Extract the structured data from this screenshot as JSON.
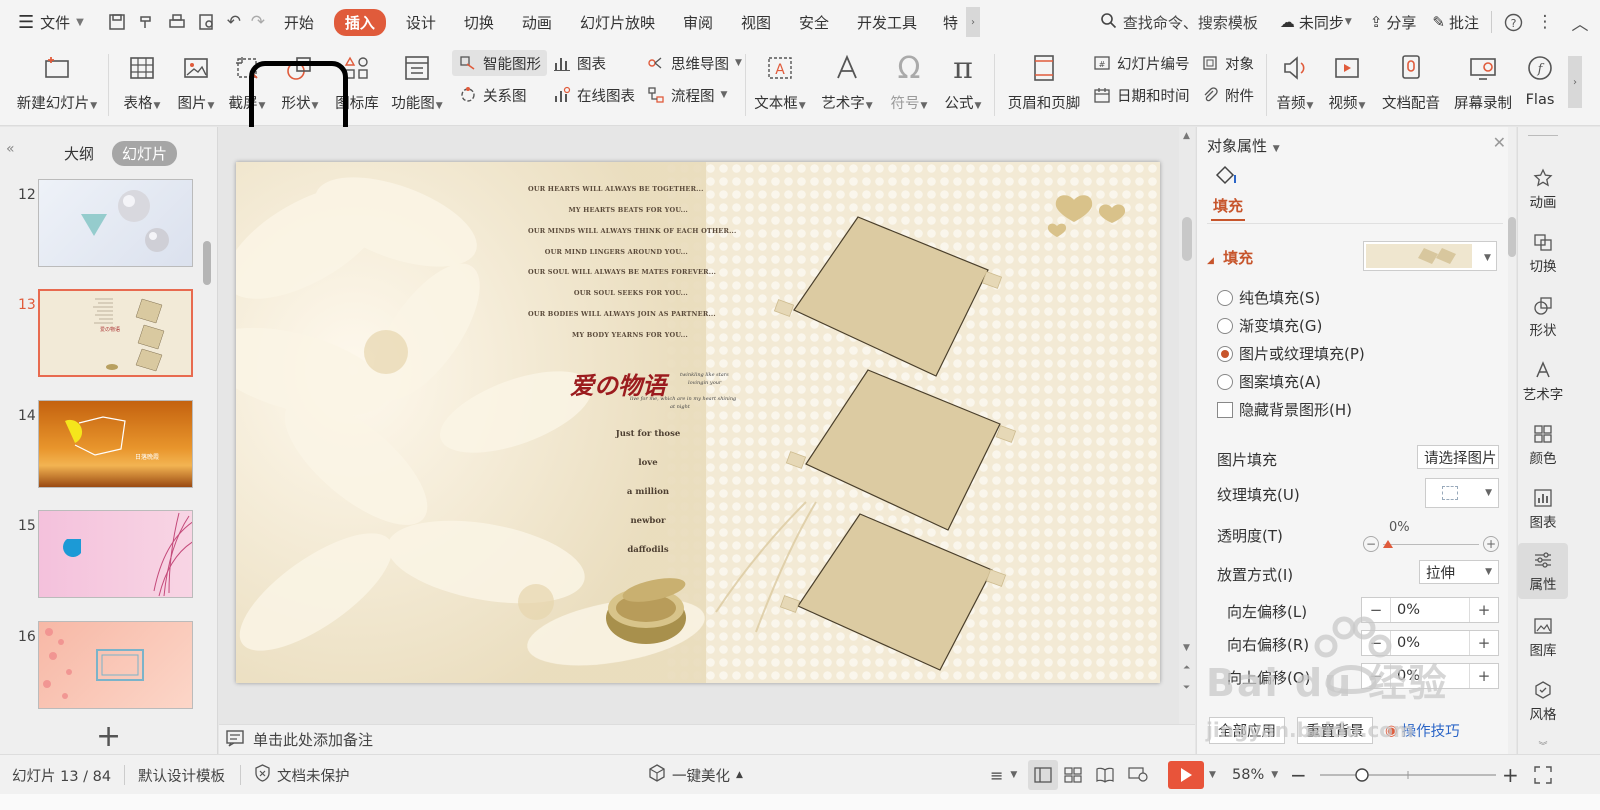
{
  "menubar": {
    "file_label": "文件",
    "tabs": [
      {
        "label": "开始",
        "active": false
      },
      {
        "label": "插入",
        "active": true
      },
      {
        "label": "设计",
        "active": false
      },
      {
        "label": "切换",
        "active": false
      },
      {
        "label": "动画",
        "active": false
      },
      {
        "label": "幻灯片放映",
        "active": false
      },
      {
        "label": "审阅",
        "active": false
      },
      {
        "label": "视图",
        "active": false
      },
      {
        "label": "安全",
        "active": false
      },
      {
        "label": "开发工具",
        "active": false
      },
      {
        "label": "特",
        "active": false
      }
    ],
    "search_label": "查找命令、搜索模板",
    "sync_label": "未同步",
    "share_label": "分享",
    "annotate_label": "批注"
  },
  "ribbon": {
    "new_slide": "新建幻灯片",
    "table": "表格",
    "picture": "图片",
    "screenshot": "截屏",
    "shape": "形状",
    "icon_lib": "图标库",
    "func_chart": "功能图",
    "smart_shape": "智能图形",
    "chart": "图表",
    "mindmap": "思维导图",
    "relation": "关系图",
    "online_chart": "在线图表",
    "flowchart": "流程图",
    "textbox": "文本框",
    "wordart": "艺术字",
    "symbol": "符号",
    "formula": "公式",
    "header_footer": "页眉和页脚",
    "slide_number": "幻灯片编号",
    "object": "对象",
    "datetime": "日期和时间",
    "attachment": "附件",
    "audio": "音频",
    "video": "视频",
    "doc_dub": "文档配音",
    "screen_rec": "屏幕录制",
    "flash": "Flas"
  },
  "leftpanel": {
    "tab_outline": "大纲",
    "tab_slides": "幻灯片",
    "thumbs": [
      {
        "num": "12"
      },
      {
        "num": "13"
      },
      {
        "num": "14"
      },
      {
        "num": "15"
      },
      {
        "num": "16"
      }
    ]
  },
  "slide": {
    "poem_lines": [
      "OUR HEARTS WILL ALWAYS BE TOGETHER...",
      "MY HEARTS BEATS FOR YOU...",
      "OUR MINDS WILL ALWAYS THINK OF EACH OTHER...",
      "OUR MIND LINGERS AROUND YOU...",
      "OUR SOUL WILL ALWAYS BE MATES FOREVER...",
      "OUR SOUL SEEKS FOR YOU...",
      "OUR BODIES WILL ALWAYS JOIN AS PARTNER...",
      "MY BODY YEARNS FOR YOU..."
    ],
    "logo_text": "爱の物语",
    "logo_sub1": "twinkling like stars",
    "logo_sub2": "lovingin your",
    "logo_sub3": "live for me, which are in my heart shining",
    "logo_sub4": "at night",
    "words": [
      "Just for those",
      "love",
      "a million",
      "newbor",
      "daffodils"
    ]
  },
  "notes": {
    "placeholder": "单击此处添加备注"
  },
  "props": {
    "title": "对象属性",
    "tab_fill": "填充",
    "section_fill": "填充",
    "fill_options": [
      {
        "label": "纯色填充(S)",
        "checked": false
      },
      {
        "label": "渐变填充(G)",
        "checked": false
      },
      {
        "label": "图片或纹理填充(P)",
        "checked": true
      },
      {
        "label": "图案填充(A)",
        "checked": false
      }
    ],
    "hide_bg_label": "隐藏背景图形(H)",
    "picture_fill_label": "图片填充",
    "picture_fill_btn": "请选择图片",
    "texture_fill_label": "纹理填充(U)",
    "transparency_label": "透明度(T)",
    "transparency_value": "0%",
    "placement_label": "放置方式(I)",
    "placement_value": "拉伸",
    "offset_left_label": "向左偏移(L)",
    "offset_left_value": "0%",
    "offset_right_label": "向右偏移(R)",
    "offset_right_value": "0%",
    "offset_up_label": "向上偏移(O)",
    "offset_up_value": "0%",
    "apply_all": "全部应用",
    "reset_bg": "重置背景",
    "tips": "操作技巧"
  },
  "rail": [
    {
      "label": "动画",
      "icon": "star-icon"
    },
    {
      "label": "切换",
      "icon": "switch-icon"
    },
    {
      "label": "形状",
      "icon": "shape-icon"
    },
    {
      "label": "艺术字",
      "icon": "wordart-icon"
    },
    {
      "label": "颜色",
      "icon": "color-icon"
    },
    {
      "label": "图表",
      "icon": "chart-icon"
    },
    {
      "label": "属性",
      "icon": "properties-icon"
    },
    {
      "label": "图库",
      "icon": "gallery-icon"
    },
    {
      "label": "风格",
      "icon": "style-icon"
    }
  ],
  "statusbar": {
    "slide_pos": "幻灯片 13 / 84",
    "template": "默认设计模板",
    "protect": "文档未保护",
    "beautify": "一键美化",
    "zoom": "58%"
  },
  "watermark": {
    "brand": "Bai du 经验",
    "url": "jingyan.baidu.com"
  },
  "colors": {
    "accent": "#e05b3b",
    "fill_section": "#c7552c",
    "link": "#2b65c7"
  }
}
